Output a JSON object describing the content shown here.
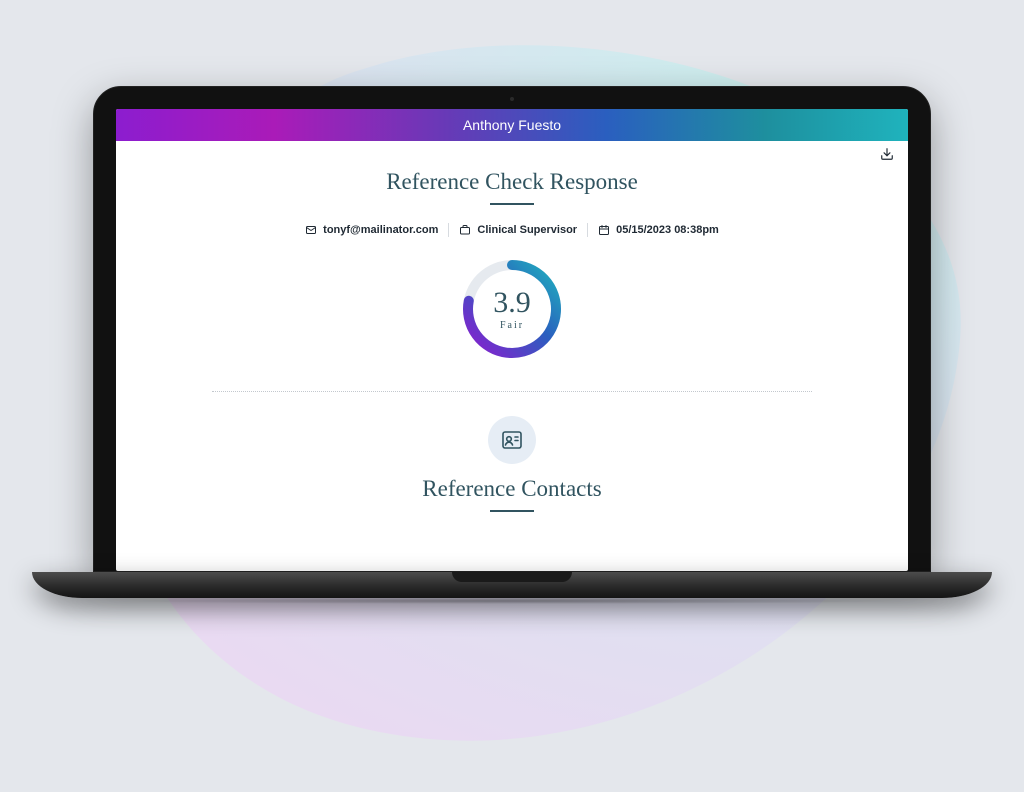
{
  "header": {
    "title": "Anthony Fuesto"
  },
  "page": {
    "heading1": "Reference Check Response",
    "heading2": "Reference Contacts"
  },
  "meta": {
    "email": "tonyf@mailinator.com",
    "role": "Clinical Supervisor",
    "datetime": "05/15/2023 08:38pm"
  },
  "score": {
    "value": "3.9",
    "label": "Fair",
    "fraction": 0.78
  },
  "colors": {
    "accent_teal": "#1fb3bd",
    "accent_purple": "#8c1dcf",
    "heading": "#315460"
  }
}
